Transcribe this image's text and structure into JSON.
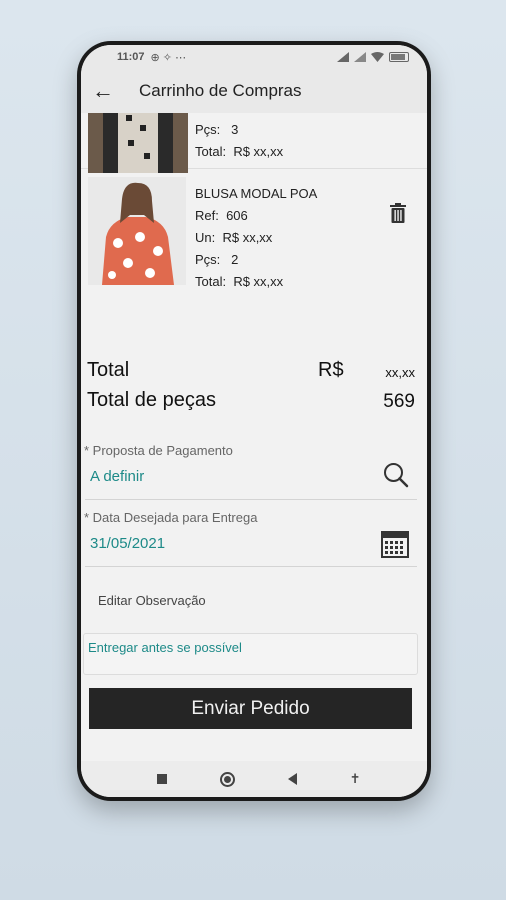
{
  "status": {
    "time": "11:07",
    "left_icons": "⊕ ✧ ⋯",
    "battery": ""
  },
  "appbar": {
    "back_icon": "←",
    "title": "Carrinho de Compras"
  },
  "items": [
    {
      "pcs_label": "Pçs:",
      "pcs": "3",
      "total_label": "Total:",
      "total": "R$  xx,xx"
    },
    {
      "name": "BLUSA MODAL  POA",
      "ref_label": "Ref:",
      "ref": "606",
      "unit_label": "Un:",
      "unit": "R$  xx,xx",
      "pcs_label": "Pçs:",
      "pcs": "2",
      "total_label": "Total:",
      "total": "R$  xx,xx"
    }
  ],
  "totals": {
    "total_label": "Total",
    "currency": "R$",
    "total_value": "xx,xx",
    "pieces_label": "Total de peças",
    "pieces_value": "569"
  },
  "payment": {
    "label": "* Proposta de Pagamento",
    "value": "A definir"
  },
  "delivery": {
    "label": "* Data Desejada para Entrega",
    "value": "31/05/2021"
  },
  "observation": {
    "label": "Editar Observação",
    "value": "Entregar antes se possível"
  },
  "send_button": "Enviar Pedido",
  "colors": {
    "accent": "#1d8a88",
    "button": "#252525"
  }
}
